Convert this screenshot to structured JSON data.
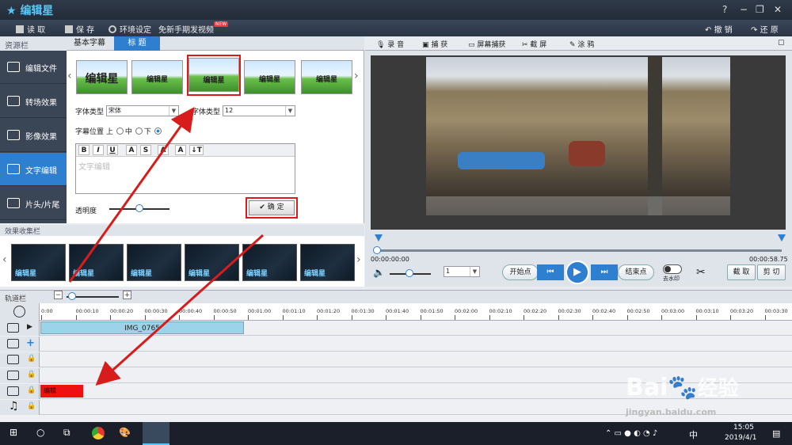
{
  "app": {
    "title": "编辑星",
    "window_controls": [
      "?",
      "−",
      "❐",
      "✕"
    ]
  },
  "toolbar": {
    "open": "读 取",
    "save": "保 存",
    "settings": "环境设定",
    "share": "免新手期发视频",
    "new_badge": "NEW",
    "undo": "撤 销",
    "redo": "还 原"
  },
  "sidebar": {
    "header": "资源栏",
    "items": [
      {
        "label": "编辑文件"
      },
      {
        "label": "转场效果"
      },
      {
        "label": "影像效果"
      },
      {
        "label": "文字编辑"
      },
      {
        "label": "片头/片尾"
      }
    ]
  },
  "subtitle_tabs": [
    {
      "label": "基本字幕"
    },
    {
      "label": "标 题"
    }
  ],
  "thumbnails": [
    "编辑星",
    "编辑星",
    "编辑星",
    "编辑星",
    "编辑星"
  ],
  "font": {
    "type_label": "字体类型",
    "type_value": "宋体",
    "size_label": "字体类型",
    "size_value": "12"
  },
  "position": {
    "label": "字幕位置",
    "top": "上",
    "middle": "中",
    "bottom": "下"
  },
  "editor": {
    "buttons": [
      "B",
      "I",
      "U",
      "A",
      "S",
      "A",
      "A",
      "↓T"
    ],
    "text": "文字编辑"
  },
  "opacity": {
    "label": "透明度",
    "value": 0.5
  },
  "confirm": "确 定",
  "effects": {
    "header": "效果收集栏",
    "items": [
      "编辑星",
      "编辑星",
      "编辑星",
      "编辑星",
      "编辑星",
      "编辑星"
    ]
  },
  "preview_toolbar": {
    "record": "录 音",
    "capture": "捕 获",
    "screen_capture": "屏幕捕获",
    "screenshot": "截 屏",
    "paint": "涂 鸦"
  },
  "playback": {
    "time_start": "00:00:00:00",
    "time_end": "00:00:58.75",
    "volume": 0.5,
    "speed": "1",
    "start_point": "开始点",
    "end_point": "结束点",
    "watermark": "去水印",
    "cut": "截 取",
    "trim": "剪 切"
  },
  "timeline": {
    "header": "轨道栏",
    "zoom_minus": "−",
    "zoom_plus": "+",
    "ticks": [
      "0:00",
      "00:00:10",
      "00:00:20",
      "00:00:30",
      "00:00:40",
      "00:00:50",
      "00:01:00",
      "00:01:10",
      "00:01:20",
      "00:01:30",
      "00:01:40",
      "00:01:50",
      "00:02:00",
      "00:02:10",
      "00:02:20",
      "00:02:30",
      "00:02:40",
      "00:02:50",
      "00:03:00",
      "00:03:10",
      "00:03:20",
      "00:03:30"
    ],
    "video_clip": "IMG_0765",
    "text_clip": "编辑"
  },
  "watermark": {
    "brand": "Bai",
    "brand2": "经验",
    "url": "jingyan.baidu.com"
  },
  "taskbar": {
    "ime": "中",
    "time": "15:05",
    "date": "2019/4/1"
  },
  "colors": {
    "accent": "#2e7fd0",
    "highlight": "#d81c1c"
  }
}
